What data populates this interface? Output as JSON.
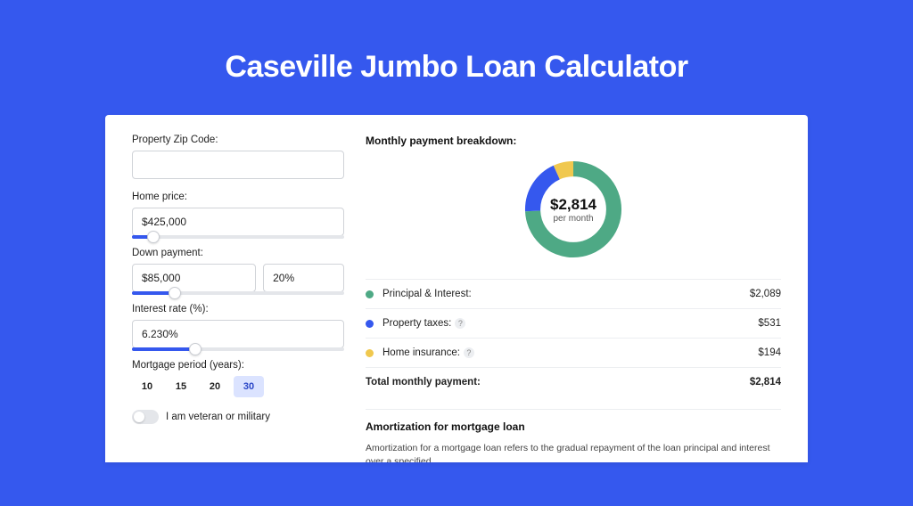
{
  "title": "Caseville Jumbo Loan Calculator",
  "form": {
    "zip": {
      "label": "Property Zip Code:",
      "value": ""
    },
    "price": {
      "label": "Home price:",
      "value": "$425,000",
      "slider_pct": 10
    },
    "down": {
      "label": "Down payment:",
      "amount": "$85,000",
      "pct": "20%",
      "slider_pct": 20
    },
    "rate": {
      "label": "Interest rate (%):",
      "value": "6.230%",
      "slider_pct": 30
    },
    "period": {
      "label": "Mortgage period (years):",
      "options": [
        "10",
        "15",
        "20",
        "30"
      ],
      "active": "30"
    },
    "veteran": {
      "label": "I am veteran or military"
    }
  },
  "breakdown": {
    "heading": "Monthly payment breakdown:",
    "center_amount": "$2,814",
    "center_sub": "per month",
    "items": [
      {
        "color": "#4ea985",
        "label": "Principal & Interest:",
        "value": "$2,089",
        "info": false
      },
      {
        "color": "#3558ee",
        "label": "Property taxes:",
        "value": "$531",
        "info": true
      },
      {
        "color": "#f0c84e",
        "label": "Home insurance:",
        "value": "$194",
        "info": true
      }
    ],
    "total": {
      "label": "Total monthly payment:",
      "value": "$2,814"
    }
  },
  "amort": {
    "heading": "Amortization for mortgage loan",
    "text": "Amortization for a mortgage loan refers to the gradual repayment of the loan principal and interest over a specified"
  },
  "chart_data": {
    "type": "pie",
    "title": "Monthly payment breakdown",
    "series": [
      {
        "name": "Principal & Interest",
        "value": 2089,
        "color": "#4ea985"
      },
      {
        "name": "Property taxes",
        "value": 531,
        "color": "#3558ee"
      },
      {
        "name": "Home insurance",
        "value": 194,
        "color": "#f0c84e"
      }
    ],
    "total": 2814,
    "center_label": "$2,814 per month"
  }
}
